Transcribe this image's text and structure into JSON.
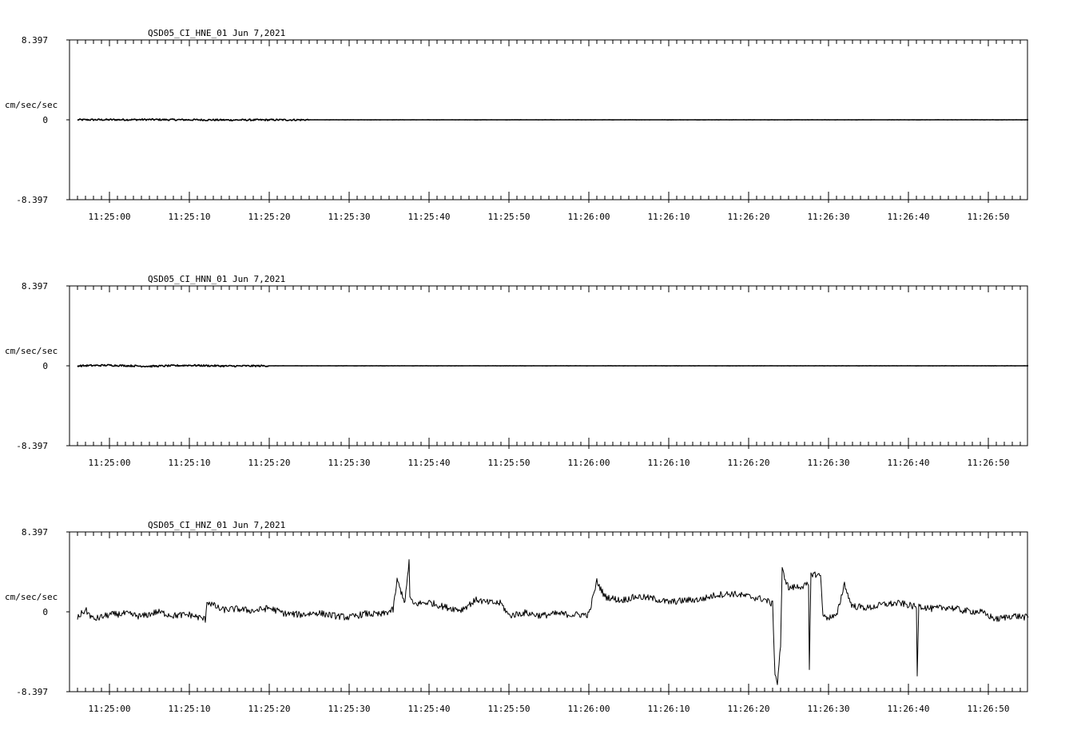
{
  "chart_data": [
    {
      "type": "line",
      "title": "QSD05_CI_HNE_01  Jun 7,2021",
      "ylabel": "cm/sec/sec",
      "ylim": [
        -8.397,
        8.397
      ],
      "y_tick_labels": [
        "8.397",
        "0",
        "-8.397"
      ],
      "x_tick_labels": [
        "11:25:00",
        "11:25:10",
        "11:25:20",
        "11:25:30",
        "11:25:40",
        "11:25:50",
        "11:26:00",
        "11:26:10",
        "11:26:20",
        "11:26:30",
        "11:26:40",
        "11:26:50"
      ],
      "series": [
        {
          "x": [
            "11:24:56",
            "11:25:05",
            "11:25:15",
            "11:25:25",
            "11:25:35",
            "11:25:45",
            "11:25:55",
            "11:26:05",
            "11:26:15",
            "11:26:25",
            "11:26:35",
            "11:26:45",
            "11:26:55"
          ],
          "values": [
            0,
            0.02,
            -0.02,
            0,
            0,
            0,
            0,
            0,
            0,
            0,
            0,
            0,
            0
          ]
        }
      ]
    },
    {
      "type": "line",
      "title": "QSD05_CI_HNN_01  Jun 7,2021",
      "ylabel": "cm/sec/sec",
      "ylim": [
        -8.397,
        8.397
      ],
      "y_tick_labels": [
        "8.397",
        "0",
        "-8.397"
      ],
      "x_tick_labels": [
        "11:25:00",
        "11:25:10",
        "11:25:20",
        "11:25:30",
        "11:25:40",
        "11:25:50",
        "11:26:00",
        "11:26:10",
        "11:26:20",
        "11:26:30",
        "11:26:40",
        "11:26:50"
      ],
      "series": [
        {
          "x": [
            "11:24:56",
            "11:25:00",
            "11:25:05",
            "11:25:10",
            "11:25:15",
            "11:25:20",
            "11:25:30",
            "11:25:40",
            "11:25:50",
            "11:26:00",
            "11:26:10",
            "11:26:20",
            "11:26:30",
            "11:26:40",
            "11:26:55"
          ],
          "values": [
            0,
            0.06,
            -0.05,
            0.05,
            -0.03,
            0,
            0,
            0,
            0,
            0,
            0,
            0,
            0,
            0,
            0
          ]
        }
      ]
    },
    {
      "type": "line",
      "title": "QSD05_CI_HNZ_01  Jun 7,2021",
      "ylabel": "cm/sec/sec",
      "ylim": [
        -8.397,
        8.397
      ],
      "y_tick_labels": [
        "8.397",
        "0",
        "-8.397"
      ],
      "x_tick_labels": [
        "11:25:00",
        "11:25:10",
        "11:25:20",
        "11:25:30",
        "11:25:40",
        "11:25:50",
        "11:26:00",
        "11:26:10",
        "11:26:20",
        "11:26:30",
        "11:26:40",
        "11:26:50"
      ],
      "series": [
        {
          "x": [
            "11:24:56",
            "11:24:57",
            "11:24:58",
            "11:25:00",
            "11:25:02",
            "11:25:04",
            "11:25:06",
            "11:25:08",
            "11:25:10",
            "11:25:12",
            "11:25:12.2",
            "11:25:14",
            "11:25:16",
            "11:25:18",
            "11:25:20",
            "11:25:22",
            "11:25:24",
            "11:25:26",
            "11:25:28",
            "11:25:30",
            "11:25:32",
            "11:25:34",
            "11:25:35.5",
            "11:25:36",
            "11:25:37",
            "11:25:37.5",
            "11:25:37.6",
            "11:25:38",
            "11:25:40",
            "11:25:42",
            "11:25:44",
            "11:25:46",
            "11:25:47",
            "11:25:49",
            "11:25:50",
            "11:25:52",
            "11:25:54",
            "11:25:56",
            "11:25:58",
            "11:26:00",
            "11:26:01",
            "11:26:02",
            "11:26:04",
            "11:26:06",
            "11:26:08",
            "11:26:10",
            "11:26:12",
            "11:26:14",
            "11:26:16",
            "11:26:18",
            "11:26:20",
            "11:26:22",
            "11:26:23",
            "11:26:23.3",
            "11:26:23.6",
            "11:26:24",
            "11:26:24.2",
            "11:26:25",
            "11:26:27.5",
            "11:26:27.6",
            "11:26:27.8",
            "11:26:28",
            "11:26:29",
            "11:26:29.3",
            "11:26:29.5",
            "11:26:31",
            "11:26:32",
            "11:26:32.5",
            "11:26:33",
            "11:26:35",
            "11:26:37",
            "11:26:39",
            "11:26:41",
            "11:26:41.1",
            "11:26:41.3",
            "11:26:41.5",
            "11:26:43",
            "11:26:45",
            "11:26:47",
            "11:26:49",
            "11:26:51",
            "11:26:52",
            "11:26:53",
            "11:26:55"
          ],
          "values": [
            -0.6,
            0.2,
            -0.8,
            -0.3,
            -0.2,
            -0.5,
            0,
            -0.4,
            -0.3,
            -0.8,
            1.1,
            0.2,
            0.3,
            0.1,
            0.4,
            -0.2,
            -0.3,
            -0.1,
            -0.4,
            -0.6,
            -0.2,
            -0.3,
            0.2,
            3.3,
            1.0,
            5.4,
            1.5,
            0.8,
            1.0,
            0.5,
            0.2,
            1.3,
            1.0,
            0.9,
            -0.4,
            -0.1,
            -0.4,
            -0.2,
            -0.3,
            -0.3,
            3.2,
            1.6,
            1.2,
            1.6,
            1.4,
            1.0,
            1.2,
            1.3,
            1.8,
            1.9,
            1.6,
            1.3,
            0.8,
            -6.5,
            -7.5,
            -3.5,
            4.4,
            2.5,
            2.8,
            -6.4,
            4.1,
            4.0,
            3.8,
            -0.1,
            -0.6,
            -0.5,
            3.0,
            1.5,
            0.6,
            0.4,
            0.8,
            0.9,
            0.5,
            -7.0,
            1.1,
            0.6,
            0.3,
            0.5,
            0.1,
            0,
            -0.8,
            -0.6,
            -0.4,
            -0.6
          ]
        }
      ]
    }
  ]
}
